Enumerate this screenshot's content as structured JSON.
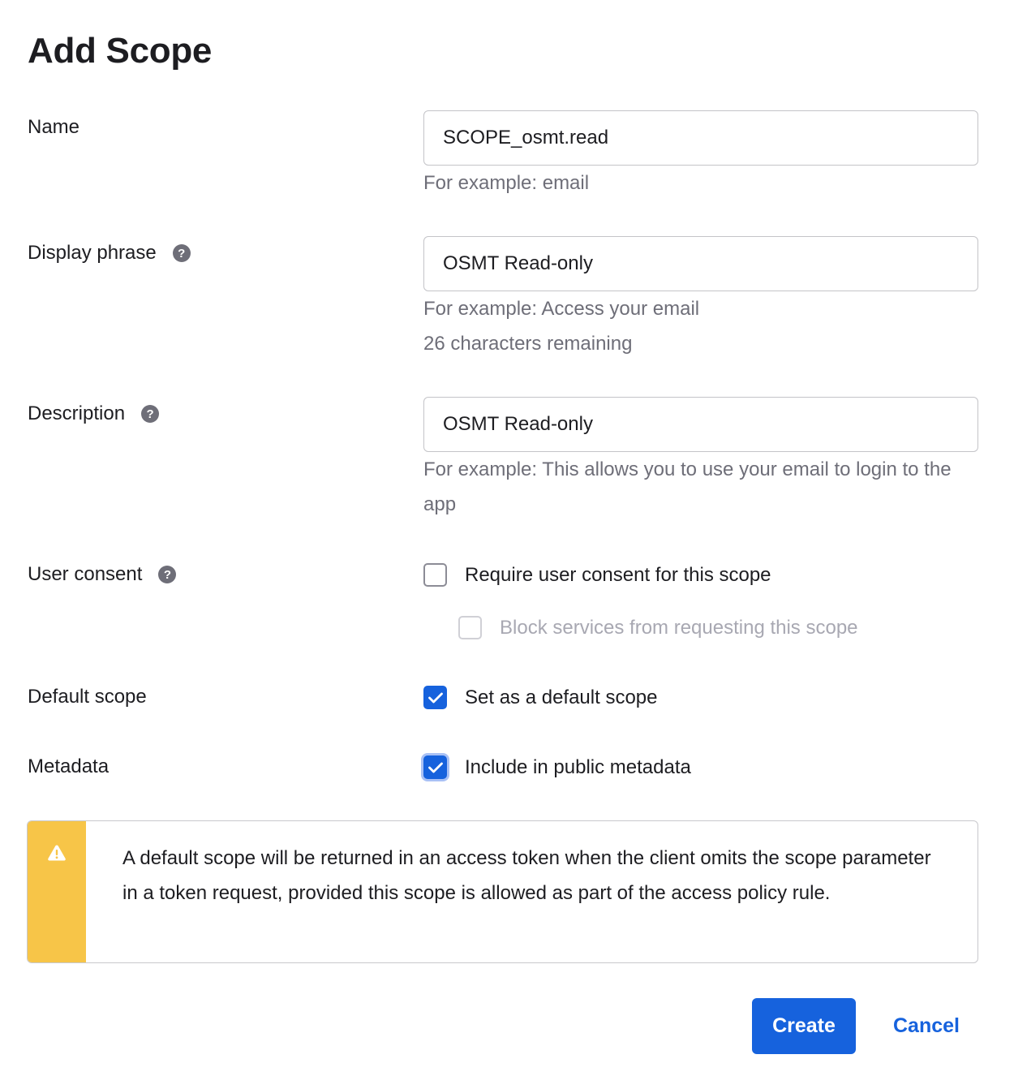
{
  "title": "Add Scope",
  "name": {
    "label": "Name",
    "value": "SCOPE_osmt.read",
    "hint": "For example: email"
  },
  "display_phrase": {
    "label": "Display phrase",
    "value": "OSMT Read-only",
    "hint": "For example: Access your email",
    "remaining": "26 characters remaining"
  },
  "description": {
    "label": "Description",
    "value": "OSMT Read-only",
    "hint": "For example: This allows you to use your email to login to the app"
  },
  "user_consent": {
    "label": "User consent",
    "require_label": "Require user consent for this scope",
    "require_checked": false,
    "block_label": "Block services from requesting this scope",
    "block_checked": false
  },
  "default_scope": {
    "label": "Default scope",
    "option_label": "Set as a default scope",
    "checked": true
  },
  "metadata": {
    "label": "Metadata",
    "option_label": "Include in public metadata",
    "checked": true
  },
  "callout": {
    "text": "A default scope will be returned in an access token when the client omits the scope parameter in a token request, provided this scope is allowed as part of the access policy rule."
  },
  "buttons": {
    "create": "Create",
    "cancel": "Cancel"
  },
  "help_glyph": "?",
  "colors": {
    "primary": "#1662dd",
    "warning": "#f7c548",
    "muted_text": "#6e6e78"
  }
}
